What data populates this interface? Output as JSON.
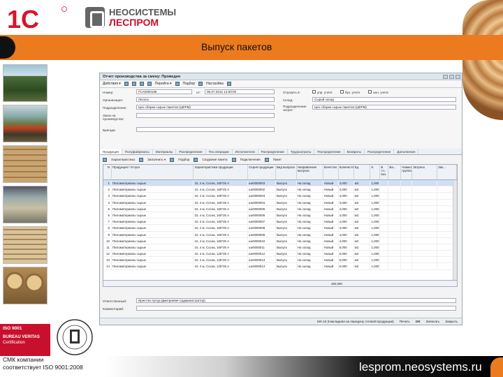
{
  "header": {
    "logo_1c": "1С",
    "brand_line1": "НЕОСИСТЕМЫ",
    "brand_line2": "ЛЕСПРОМ",
    "slide_title": "Выпуск пакетов"
  },
  "footer": {
    "iso_badge": [
      "ISO 9001",
      "BUREAU VERITAS",
      "Certification"
    ],
    "qms_line1": "СМК компании",
    "qms_line2": "соответствует ISO 9001:2008",
    "website": "lesprom.neosystems.ru"
  },
  "window": {
    "title": "Отчет производства за смену: Проведен",
    "toolbar": [
      "Действия ▾",
      "Перейти ▾",
      "Подбор",
      "Настройка"
    ],
    "form": {
      "number_label": "Номер:",
      "number_value": "ГСА0000186",
      "date_label": "от:",
      "date_value": "06.07.2012 12:00:00",
      "warehouse_label": "Склад:",
      "warehouse_value": "Сырой склад",
      "org_label": "Организация:",
      "org_value": "Лесхоз",
      "subdiv_label": "Подразделение:",
      "subdiv_value": "Цех сборки сырых пакетов (ЦФРМ)",
      "responsible_subdiv_label": "Подразделение затрат:",
      "responsible_subdiv_value": "Цех сборки сырых пакетов (ЦФРМ)",
      "order_label": "Заказ на производство:",
      "comment_label": "Бригада:",
      "reflect_label": "Отразить в:",
      "reflect_opts": [
        "упр. учете",
        "бух. учете",
        "нал. учете"
      ]
    },
    "tabs": [
      "Продукция",
      "Полуфабрикаты",
      "Материалы",
      "Распределение",
      "Тех.операции",
      "Исполнители",
      "Распределение",
      "Трудозатраты",
      "Распределение",
      "Возвраты",
      "Распределение",
      "Дополнения"
    ],
    "subtoolbar": [
      "Характеристика",
      "Заполнить ▾",
      "Подбор",
      "Создание пакета",
      "Подключения",
      "Пакет"
    ],
    "columns": [
      "N",
      "Продукция / Услуга",
      "Характеристика продукции",
      "Серия продукции",
      "Вид выпуска",
      "Направление выпуска",
      "Качество",
      "Количество",
      "Ед.",
      "К.",
      "В т.ч. воз.",
      "Ва...",
      "Номенклатурная группа",
      "Затраты",
      "Зак..."
    ],
    "rows": [
      [
        "1",
        "Пиломатериалы сырые",
        "10, 4 м, Сосна, 160*25 А",
        "ше0000003",
        "Выпуск",
        "На склад",
        "Новый",
        "4,000",
        "м3",
        "1,000"
      ],
      [
        "2",
        "Пиломатериалы сырые",
        "10, 4 м, Сосна, 160*25 А",
        "ше0000002",
        "Выпуск",
        "На склад",
        "Новый",
        "4,000",
        "м3",
        "1,000"
      ],
      [
        "3",
        "Пиломатериалы сырые",
        "10, 4 м, Сосна, 160*25 А",
        "ше0000003",
        "Выпуск",
        "На склад",
        "Новый",
        "4,000",
        "м3",
        "1,000"
      ],
      [
        "4",
        "Пиломатериалы сырые",
        "10, 4 м, Сосна, 160*25 А",
        "ше0000004",
        "Выпуск",
        "На склад",
        "Новый",
        "4,000",
        "м3",
        "1,000"
      ],
      [
        "5",
        "Пиломатериалы сырые",
        "10, 4 м, Сосна, 160*25 А",
        "ше0000005",
        "Выпуск",
        "На склад",
        "Новый",
        "4,000",
        "м3",
        "1,000"
      ],
      [
        "6",
        "Пиломатериалы сырые",
        "10, 4 м, Сосна, 160*25 А",
        "ше0000006",
        "Выпуск",
        "На склад",
        "Новый",
        "4,000",
        "м3",
        "1,000"
      ],
      [
        "7",
        "Пиломатериалы сырые",
        "10, 4 м, Сосна, 160*25 А",
        "ше0000007",
        "Выпуск",
        "На склад",
        "Новый",
        "4,000",
        "м3",
        "1,000"
      ],
      [
        "8",
        "Пиломатериалы сырые",
        "10, 4 м, Сосна, 160*25 А",
        "ше0000008",
        "Выпуск",
        "На склад",
        "Новый",
        "4,000",
        "м3",
        "1,000"
      ],
      [
        "9",
        "Пиломатериалы сырые",
        "10, 4 м, Сосна, 160*25 А",
        "ше0000009",
        "Выпуск",
        "На склад",
        "Новый",
        "4,000",
        "м3",
        "1,000"
      ],
      [
        "10",
        "Пиломатериалы сырые",
        "10, 4 м, Сосна, 160*25 А",
        "ше0000010",
        "Выпуск",
        "На склад",
        "Новый",
        "4,000",
        "м3",
        "1,000"
      ],
      [
        "11",
        "Пиломатериалы сырые",
        "10, 4 м, Сосна, 160*25 А",
        "ше0000011",
        "Выпуск",
        "На склад",
        "Новый",
        "5,000",
        "м3",
        "1,000"
      ],
      [
        "12",
        "Пиломатериалы сырые",
        "10, 4 м, Сосна, 125*25 А",
        "ше0000012",
        "Выпуск",
        "На склад",
        "Новый",
        "5,000",
        "м3",
        "1,000"
      ],
      [
        "13",
        "Пиломатериалы сырые",
        "10, 4 м, Сосна, 125*25 А",
        "ше0000013",
        "Выпуск",
        "На склад",
        "Новый",
        "5,000",
        "м3",
        "1,000"
      ],
      [
        "14",
        "Пиломатериалы сырые",
        "10, 4 м, Сосна, 125*25 А",
        "ше0000014",
        "Выпуск",
        "На склад",
        "Новый",
        "5,000",
        "м3",
        "1,000"
      ]
    ],
    "total": "492,000",
    "responsible_label": "Ответственный:",
    "responsible_value": "Иристов Артур Дмитриевич (администратор)",
    "comment_field_label": "Комментарий:",
    "statusbar": [
      "МХ-18 (Накладная на передачу готовой продукции)",
      "Печать",
      "OK",
      "Записать",
      "Закрыть"
    ]
  }
}
